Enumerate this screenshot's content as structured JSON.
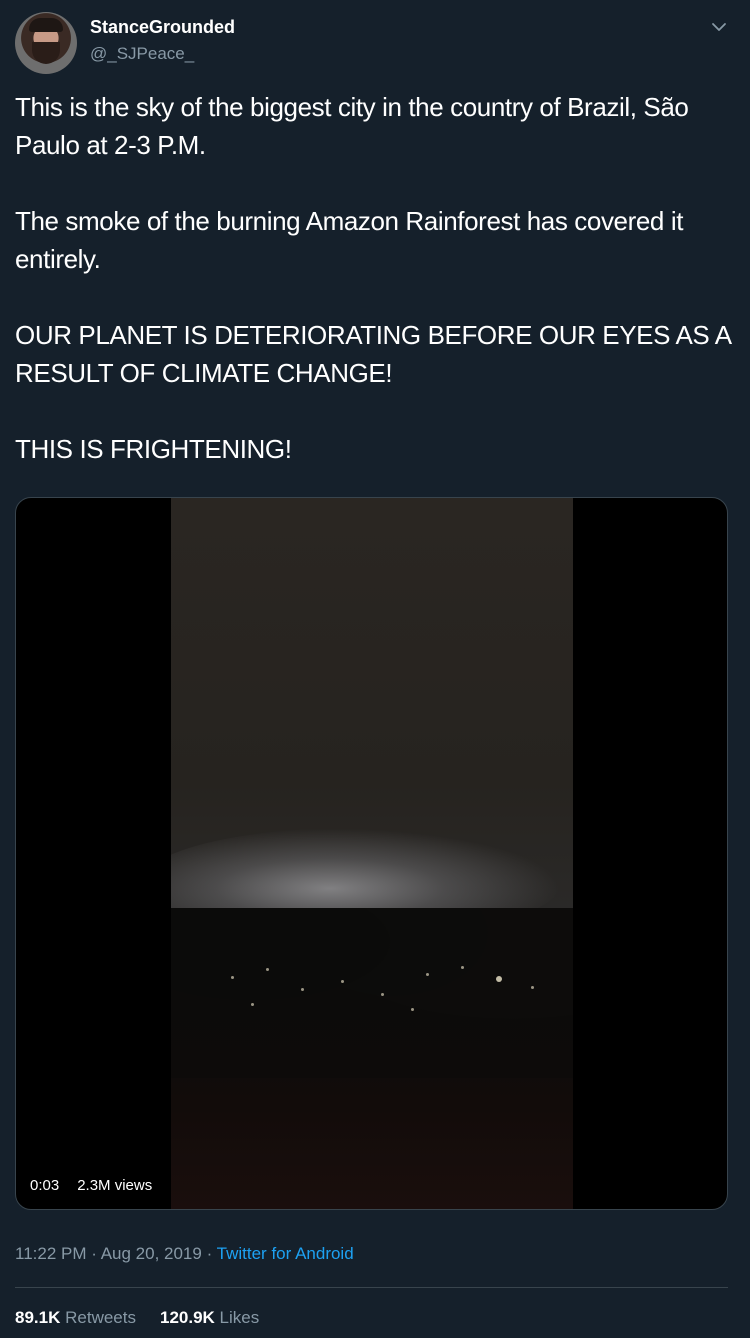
{
  "author": {
    "display_name": "StanceGrounded",
    "handle": "@_SJPeace_"
  },
  "tweet": {
    "paragraphs": [
      "This is the sky of the biggest city in the country of Brazil, São Paulo at 2-3 P.M.",
      "The smoke of the burning Amazon Rainforest has covered it entirely.",
      "OUR PLANET IS DETERIORATING BEFORE OUR EYES AS A RESULT OF CLIMATE CHANGE!",
      "THIS IS FRIGHTENING!"
    ]
  },
  "video": {
    "duration": "0:03",
    "views": "2.3M views"
  },
  "meta": {
    "time": "11:22 PM",
    "separator": " · ",
    "date": "Aug 20, 2019",
    "source": "Twitter for Android"
  },
  "stats": {
    "retweets_count": "89.1K",
    "retweets_label": "Retweets",
    "likes_count": "120.9K",
    "likes_label": "Likes"
  },
  "icons": {
    "menu": "chevron-down-icon"
  },
  "colors": {
    "background": "#15202b",
    "secondary_text": "#8899a6",
    "link": "#1da1f2",
    "border": "#38444d"
  }
}
